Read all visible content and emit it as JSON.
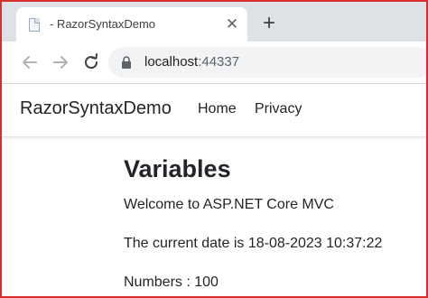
{
  "browser": {
    "tab": {
      "title": "- RazorSyntaxDemo"
    },
    "address": {
      "host": "localhost",
      "port": ":44337"
    }
  },
  "site": {
    "brand": "RazorSyntaxDemo",
    "nav": [
      {
        "label": "Home"
      },
      {
        "label": "Privacy"
      }
    ]
  },
  "main": {
    "heading": "Variables",
    "welcome": "Welcome to ASP.NET Core MVC",
    "date_line": "The current date is 18-08-2023 10:37:22",
    "numbers_line": "Numbers : 100"
  },
  "colors": {
    "frame_border": "#d92e2e",
    "tabstrip": "#dee1e6",
    "omnibox": "#f1f3f4"
  },
  "icons": [
    "page-favicon-icon",
    "close-icon",
    "plus-icon",
    "back-arrow-icon",
    "forward-arrow-icon",
    "reload-icon",
    "lock-icon"
  ]
}
